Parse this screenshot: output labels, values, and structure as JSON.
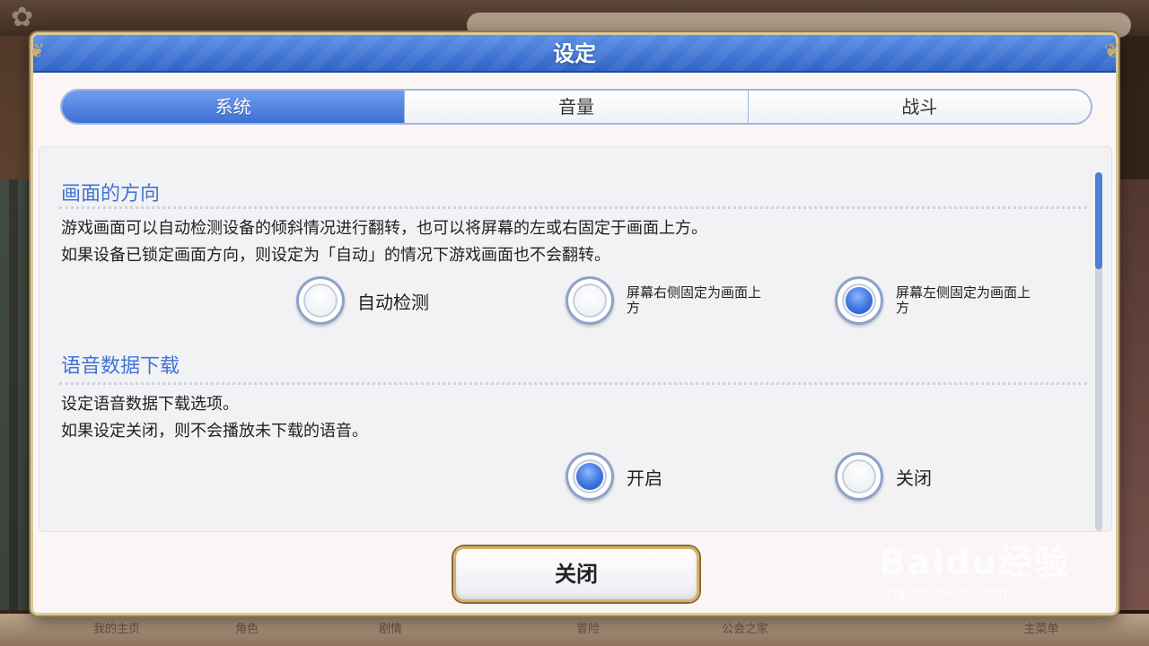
{
  "dialog": {
    "title": "设定"
  },
  "tabs": [
    {
      "label": "系统",
      "active": true
    },
    {
      "label": "音量",
      "active": false
    },
    {
      "label": "战斗",
      "active": false
    }
  ],
  "sections": {
    "orientation": {
      "title": "画面的方向",
      "desc_line1": "游戏画面可以自动检测设备的倾斜情况进行翻转，也可以将屏幕的左或右固定于画面上方。",
      "desc_line2": "如果设备已锁定画面方向，则设定为「自动」的情况下游戏画面也不会翻转。",
      "options": [
        {
          "label": "自动检测",
          "selected": false
        },
        {
          "label": "屏幕右侧固定为画面上方",
          "selected": false
        },
        {
          "label": "屏幕左侧固定为画面上方",
          "selected": true
        }
      ]
    },
    "voice_download": {
      "title": "语音数据下载",
      "desc_line1": "设定语音数据下载选项。",
      "desc_line2": "如果设定关闭，则不会播放未下载的语音。",
      "options": [
        {
          "label": "开启",
          "selected": true
        },
        {
          "label": "关闭",
          "selected": false
        }
      ]
    }
  },
  "close_button": "关闭",
  "background": {
    "nav_items": [
      "我的主页",
      "角色",
      "剧情",
      "冒险",
      "公会之家",
      "主菜单"
    ]
  },
  "watermark": {
    "main": "Baidu经验",
    "sub": "jingyan.baidu.com"
  },
  "colors": {
    "title_blue": "#3f70d4",
    "section_title": "#3f74d6",
    "radio_selected": "#3d74e0",
    "button_border": "#d6b26a"
  },
  "scroll_position": 0.0
}
